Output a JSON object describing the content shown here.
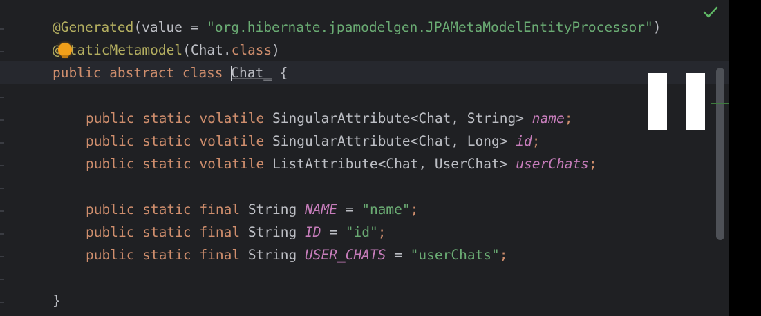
{
  "editor": {
    "lines": {
      "generated": {
        "annotation": "@Generated",
        "open": "(value = ",
        "value": "\"org.hibernate.jpamodelgen.JPAMetaModelEntityProcessor\"",
        "close": ")"
      },
      "static_metamodel": {
        "annotation_prefix": "@",
        "annotation_rest": "taticMetamodel",
        "args_open": "(Chat.",
        "class_kw": "class",
        "args_close": ")"
      },
      "class_decl": {
        "modifiers": "public abstract class ",
        "name": "Chat_",
        "brace": " {"
      },
      "field_name": {
        "modifiers": "public static volatile ",
        "type": "SingularAttribute<Chat, String> ",
        "field": "name",
        "end": ";"
      },
      "field_id": {
        "modifiers": "public static volatile ",
        "type": "SingularAttribute<Chat, Long> ",
        "field": "id",
        "end": ";"
      },
      "field_user_chats": {
        "modifiers": "public static volatile ",
        "type": "ListAttribute<Chat, UserChat> ",
        "field": "userChats",
        "end": ";"
      },
      "const_name": {
        "modifiers": "public static final ",
        "type": "String ",
        "field": "NAME",
        "eq": " = ",
        "value": "\"name\"",
        "end": ";"
      },
      "const_id": {
        "modifiers": "public static final ",
        "type": "String ",
        "field": "ID",
        "eq": " = ",
        "value": "\"id\"",
        "end": ";"
      },
      "const_user_chats": {
        "modifiers": "public static final ",
        "type": "String ",
        "field": "USER_CHATS",
        "eq": " = ",
        "value": "\"userChats\"",
        "end": ";"
      },
      "closing": {
        "brace": "}"
      }
    }
  },
  "icons": {
    "inspection": "check-icon",
    "intention": "lightbulb-icon",
    "overlay": "pause-icon"
  },
  "colors": {
    "background": "#1f2023",
    "annotation": "#b3ae60",
    "keyword": "#cf8e6d",
    "string": "#6aab73",
    "field": "#c77dbb",
    "text": "#bcbec4",
    "check": "#5fb865",
    "bulb": "#f2a01a"
  }
}
